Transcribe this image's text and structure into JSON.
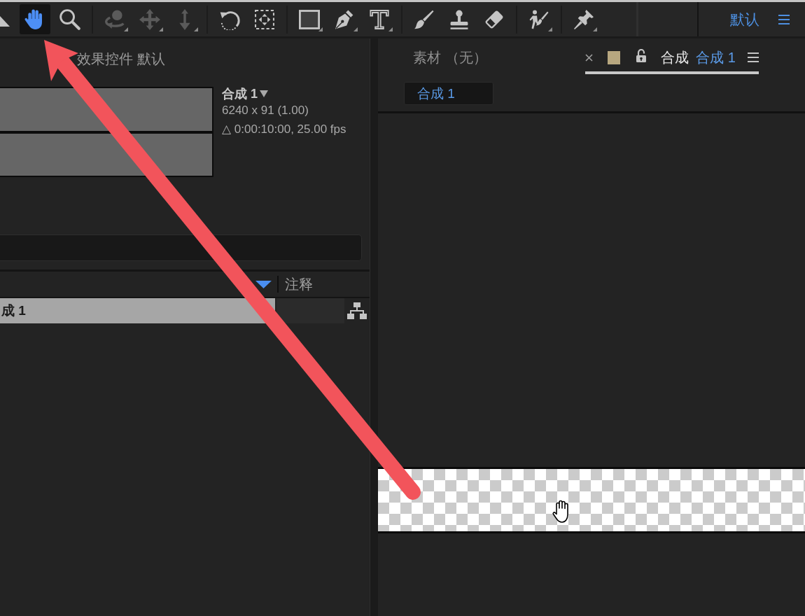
{
  "toolbar": {
    "tool_groups": [
      {
        "tools": [
          {
            "kind": "selection",
            "selected": false,
            "disabled": false,
            "flyout": false
          },
          {
            "kind": "hand",
            "selected": true,
            "disabled": false,
            "flyout": false
          },
          {
            "kind": "zoom",
            "selected": false,
            "disabled": false,
            "flyout": false
          }
        ]
      },
      {
        "tools": [
          {
            "kind": "orbit",
            "selected": false,
            "disabled": true,
            "flyout": true
          },
          {
            "kind": "pan",
            "selected": false,
            "disabled": true,
            "flyout": true
          },
          {
            "kind": "dolly",
            "selected": false,
            "disabled": true,
            "flyout": true
          }
        ]
      },
      {
        "tools": [
          {
            "kind": "rotate",
            "selected": false,
            "disabled": false,
            "flyout": false
          },
          {
            "kind": "pan-behind",
            "selected": false,
            "disabled": false,
            "flyout": false
          }
        ]
      },
      {
        "tools": [
          {
            "kind": "rectangle",
            "selected": false,
            "disabled": false,
            "flyout": true
          },
          {
            "kind": "pen",
            "selected": false,
            "disabled": false,
            "flyout": true
          },
          {
            "kind": "type",
            "selected": false,
            "disabled": false,
            "flyout": true
          }
        ]
      },
      {
        "tools": [
          {
            "kind": "brush",
            "selected": false,
            "disabled": false,
            "flyout": false
          },
          {
            "kind": "clone-stamp",
            "selected": false,
            "disabled": false,
            "flyout": false
          },
          {
            "kind": "eraser",
            "selected": false,
            "disabled": false,
            "flyout": false
          }
        ]
      },
      {
        "tools": [
          {
            "kind": "roto-brush",
            "selected": false,
            "disabled": false,
            "flyout": true
          }
        ]
      },
      {
        "tools": [
          {
            "kind": "puppet-pin",
            "selected": false,
            "disabled": false,
            "flyout": true
          }
        ]
      }
    ],
    "workspace": {
      "label": "默认",
      "selected": true
    }
  },
  "project_panel": {
    "tabs": [
      {
        "label": "效果控件 默认",
        "selected": false
      }
    ],
    "preview": {
      "title": "合成 1",
      "details": [
        "6240 x 91 (1.00)",
        "△ 0:00:10:00, 25.00 fps"
      ]
    },
    "table": {
      "columns": [
        {
          "sorted": true
        },
        {
          "label": "注释",
          "sorted": false
        }
      ],
      "rows": [
        {
          "name": "成 1",
          "selected": true
        }
      ]
    }
  },
  "viewer_panel": {
    "tabs": [
      {
        "kind": "footage",
        "label": "素材 （无）",
        "selected": false
      },
      {
        "kind": "composition",
        "prefix": "合成",
        "label": "合成 1",
        "selected": true,
        "color": "#b8a77f",
        "locked": false
      }
    ],
    "navigator": [
      {
        "label": "合成 1"
      }
    ]
  },
  "annotations": [
    {
      "kind": "arrow"
    }
  ]
}
